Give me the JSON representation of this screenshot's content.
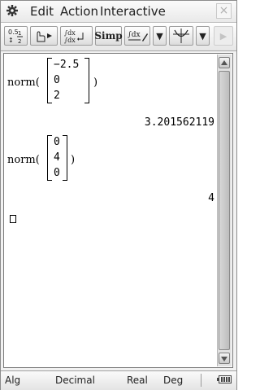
{
  "menu": {
    "edit": "Edit",
    "action": "Action",
    "interactive": "Interactive",
    "close_glyph": "×"
  },
  "toolbar": {
    "simp_label": "Simp",
    "dropdown_glyph": "▼",
    "next_glyph": "▶"
  },
  "work": {
    "entry1": {
      "func": "norm(",
      "matrix": [
        "−2.5",
        "0",
        "2"
      ],
      "close": ")",
      "result": "3.201562119"
    },
    "entry2": {
      "func": "norm(",
      "matrix": [
        "0",
        "4",
        "0"
      ],
      "close": ")",
      "result": "4"
    }
  },
  "status": {
    "mode": "Alg",
    "format": "Decimal",
    "number": "Real",
    "angle": "Deg"
  },
  "icons": [
    "gear-icon",
    "fraction-decimal-icon",
    "hand-pointer-icon",
    "integral-definite-icon",
    "integral-draw-icon",
    "graph-icon",
    "close-icon",
    "battery-icon",
    "scroll-up-icon",
    "scroll-down-icon"
  ]
}
